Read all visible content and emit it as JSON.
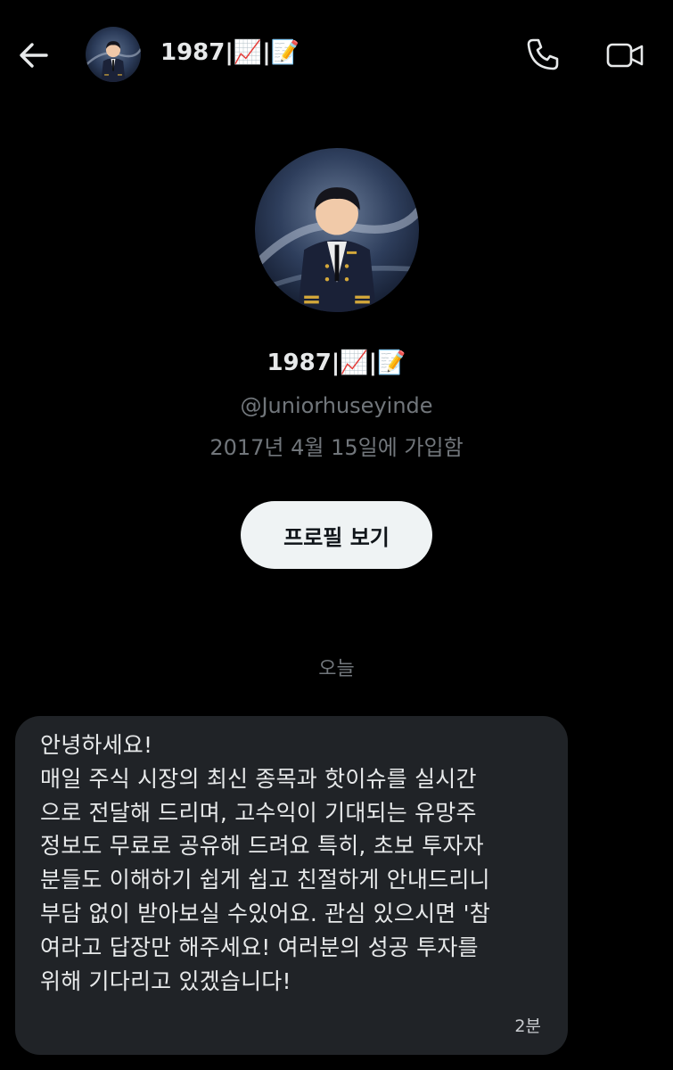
{
  "header": {
    "name": "1987|📈|📝",
    "back_icon": "arrow-left-icon",
    "call_icon": "phone-icon",
    "video_icon": "video-camera-icon"
  },
  "profile": {
    "name": "1987|📈|📝",
    "handle": "@Juniorhuseyinde",
    "joined": "2017년 4월 15일에 가입함",
    "view_profile_label": "프로필 보기"
  },
  "conversation": {
    "date_separator": "오늘",
    "messages": [
      {
        "text": "안녕하세요!\n매일 주식 시장의 최신 종목과 핫이슈를 실시간\n으로 전달해 드리며, 고수익이 기대되는 유망주\n정보도 무료로 공유해 드려요 특히, 초보 투자자\n분들도 이해하기 쉽게 쉽고 친절하게 안내드리니\n부담 없이 받아보실 수있어요. 관심 있으시면 '참\n여라고 답장만 해주세요! 여러분의 성공 투자를\n위해 기다리고 있겠습니다!",
        "time": "2분"
      }
    ]
  },
  "colors": {
    "background": "#000000",
    "bubble": "#202327",
    "primary_text": "#e7e9ea",
    "secondary_text": "#71767b",
    "button_bg": "#eff3f4"
  }
}
